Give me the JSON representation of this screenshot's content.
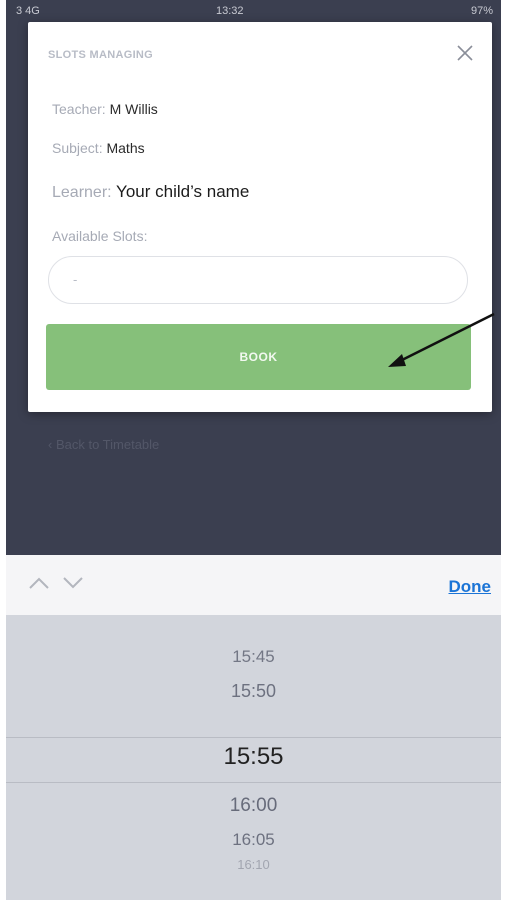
{
  "status_bar": {
    "carrier": "3  4G",
    "time": "13:32",
    "battery": "97%"
  },
  "modal": {
    "title": "SLOTS MANAGING",
    "teacher_label": "Teacher:",
    "teacher_value": "M Willis",
    "subject_label": "Subject:",
    "subject_value": "Maths",
    "learner_label": "Learner:",
    "learner_value": "Your child’s name",
    "slots_label": "Available Slots:",
    "slots_value": "-",
    "book_label": "BOOK"
  },
  "background": {
    "faded_link": "‹ Back to Timetable"
  },
  "toolbar": {
    "done_label": "Done"
  },
  "picker": {
    "items": [
      "15:45",
      "15:50",
      "15:55",
      "16:00",
      "16:05",
      "16:10"
    ],
    "selected": "15:55"
  },
  "colors": {
    "book_button": "#86c07a",
    "done_link": "#1b74d6",
    "app_background": "#3b3f50",
    "picker_background": "#d2d5dc"
  }
}
